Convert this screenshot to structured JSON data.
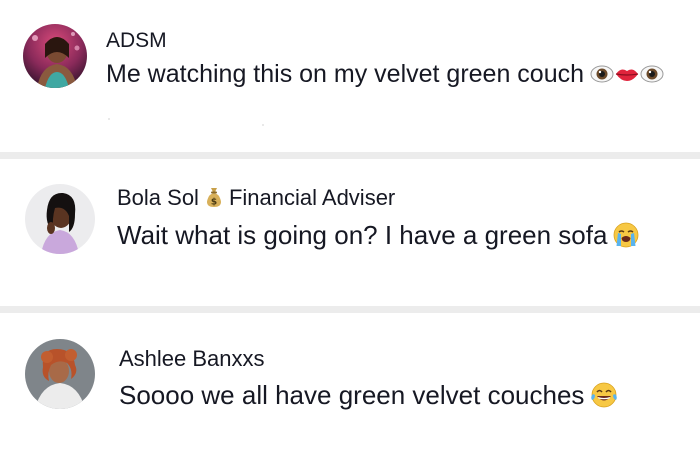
{
  "comments": [
    {
      "username": "ADSM",
      "text": "Me watching this on my velvet green couch",
      "emoji": "eyes-lips-eyes"
    },
    {
      "username_name": "Bola Sol",
      "username_title": "Financial Adviser",
      "badge_icon": "money-bag-icon",
      "text": "Wait what is going on? I have a green sofa",
      "emoji": "loudly-crying-face"
    },
    {
      "username": "Ashlee Banxxs",
      "text": "Soooo we all have green velvet couches",
      "emoji": "face-with-tears-of-joy"
    }
  ],
  "colors": {
    "text": "#161823",
    "divider": "#ececec",
    "background": "#ffffff"
  }
}
